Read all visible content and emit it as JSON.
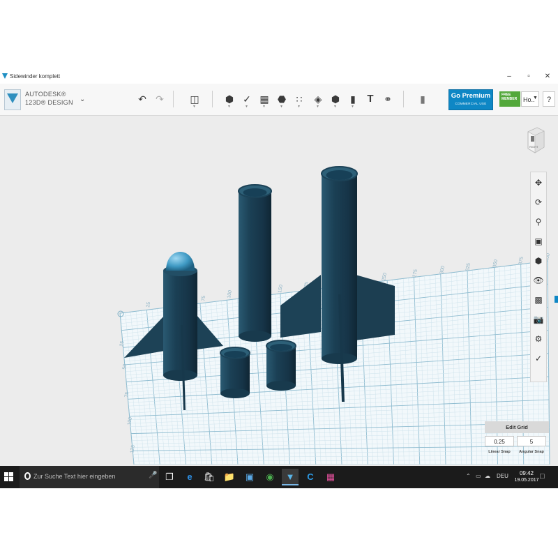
{
  "window": {
    "title": "Sidewinder komplett",
    "controls": {
      "minimize": "–",
      "maximize": "▫",
      "close": "✕"
    }
  },
  "app": {
    "brand_line1": "AUTODESK®",
    "brand_line2": "123D® DESIGN"
  },
  "toolbar": {
    "go_premium": "Go Premium",
    "go_premium_sub": "COMMERCIAL USE",
    "free_badge_line1": "FREE",
    "free_badge_line2": "MEMBER",
    "user_menu": "Ho..",
    "help": "?"
  },
  "grid": {
    "axis_labels": [
      "25",
      "75",
      "100",
      "125",
      "150",
      "175",
      "200",
      "225",
      "250",
      "275",
      "300",
      "325",
      "350",
      "375",
      "400"
    ],
    "side_labels": [
      "25",
      "50",
      "75",
      "100",
      "125"
    ],
    "minor_color": "#cfe3ec",
    "major_color": "#8fbcd0",
    "model_color": "#1d4256"
  },
  "edit_grid": {
    "title": "Edit Grid",
    "linear_snap_value": "0.25",
    "angular_snap_value": "5",
    "linear_snap_label": "Linear Snap",
    "angular_snap_label": "Angular Snap"
  },
  "view_cube": {
    "label": "RIGHT"
  },
  "taskbar": {
    "search_placeholder": "Zur Suche Text hier eingeben",
    "language": "DEU",
    "time": "09:42",
    "date": "19.05.2017",
    "apps": [
      "task-view-icon",
      "edge-icon",
      "store-icon",
      "explorer-icon",
      "photos-icon",
      "chrome-icon",
      "123d-design-icon",
      "cortana-c-icon",
      "app-icon"
    ]
  }
}
